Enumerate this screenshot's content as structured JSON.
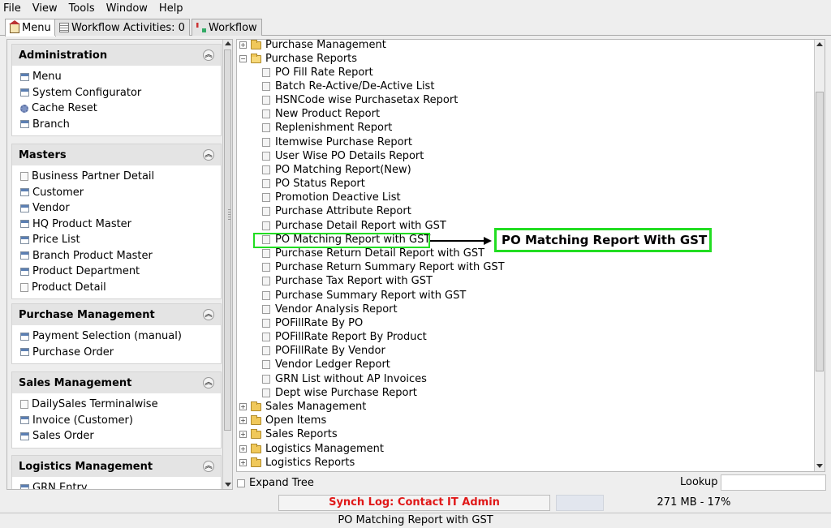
{
  "menubar": {
    "file": "File",
    "view": "View",
    "tools": "Tools",
    "window": "Window",
    "help": "Help"
  },
  "tabs": {
    "menu": "Menu",
    "workflow_activities": "Workflow Activities: 0",
    "workflow": "Workflow"
  },
  "sidebar": {
    "sections": [
      {
        "title": "Administration",
        "items": [
          {
            "label": "Menu",
            "icon": "window-icon"
          },
          {
            "label": "System Configurator",
            "icon": "window-icon"
          },
          {
            "label": "Cache Reset",
            "icon": "gear-icon"
          },
          {
            "label": "Branch",
            "icon": "window-icon"
          }
        ]
      },
      {
        "title": "Masters",
        "items": [
          {
            "label": "Business Partner Detail",
            "icon": "document-icon"
          },
          {
            "label": "Customer",
            "icon": "window-icon"
          },
          {
            "label": "Vendor",
            "icon": "window-icon"
          },
          {
            "label": "HQ Product Master",
            "icon": "window-icon"
          },
          {
            "label": "Price List",
            "icon": "window-icon"
          },
          {
            "label": "Branch Product Master",
            "icon": "window-icon"
          },
          {
            "label": "Product Department",
            "icon": "window-icon"
          },
          {
            "label": "Product Detail",
            "icon": "document-icon"
          }
        ]
      },
      {
        "title": "Purchase Management",
        "items": [
          {
            "label": "Payment Selection (manual)",
            "icon": "window-icon"
          },
          {
            "label": "Purchase Order",
            "icon": "window-icon"
          }
        ]
      },
      {
        "title": "Sales Management",
        "items": [
          {
            "label": "DailySales Terminalwise",
            "icon": "document-icon"
          },
          {
            "label": "Invoice (Customer)",
            "icon": "window-icon"
          },
          {
            "label": "Sales Order",
            "icon": "window-icon"
          }
        ]
      },
      {
        "title": "Logistics Management",
        "items": [
          {
            "label": "GRN Entry",
            "icon": "window-icon"
          }
        ]
      }
    ]
  },
  "tree": {
    "nodes": [
      {
        "label": "Purchase Management",
        "type": "folder",
        "expanded": false,
        "level": 0
      },
      {
        "label": "Purchase Reports",
        "type": "folder",
        "expanded": true,
        "level": 0
      },
      {
        "label": "PO Fill Rate Report",
        "type": "report",
        "level": 1
      },
      {
        "label": "Batch Re-Active/De-Active List",
        "type": "report",
        "level": 1
      },
      {
        "label": "HSNCode wise Purchasetax Report",
        "type": "report",
        "level": 1
      },
      {
        "label": "New Product Report",
        "type": "report",
        "level": 1
      },
      {
        "label": "Replenishment Report",
        "type": "report",
        "level": 1
      },
      {
        "label": "Itemwise Purchase Report",
        "type": "report",
        "level": 1
      },
      {
        "label": "User Wise PO Details Report",
        "type": "report",
        "level": 1
      },
      {
        "label": "PO Matching Report(New)",
        "type": "report",
        "level": 1
      },
      {
        "label": "PO Status Report",
        "type": "report",
        "level": 1
      },
      {
        "label": "Promotion Deactive List",
        "type": "report",
        "level": 1
      },
      {
        "label": "Purchase Attribute Report",
        "type": "report",
        "level": 1
      },
      {
        "label": "Purchase Detail Report with GST",
        "type": "report",
        "level": 1
      },
      {
        "label": "PO Matching Report with GST",
        "type": "report",
        "level": 1,
        "highlighted": true
      },
      {
        "label": "Purchase Return Detail Report with GST",
        "type": "report",
        "level": 1
      },
      {
        "label": "Purchase Return Summary Report with GST",
        "type": "report",
        "level": 1
      },
      {
        "label": "Purchase Tax Report with GST",
        "type": "report",
        "level": 1
      },
      {
        "label": "Purchase Summary Report with GST",
        "type": "report",
        "level": 1
      },
      {
        "label": "Vendor Analysis Report",
        "type": "report",
        "level": 1
      },
      {
        "label": "POFillRate By PO",
        "type": "report",
        "level": 1
      },
      {
        "label": "POFillRate Report By Product",
        "type": "report",
        "level": 1
      },
      {
        "label": "POFillRate By Vendor",
        "type": "report",
        "level": 1
      },
      {
        "label": "Vendor Ledger Report",
        "type": "report",
        "level": 1
      },
      {
        "label": "GRN List without AP Invoices",
        "type": "report",
        "level": 1
      },
      {
        "label": "Dept wise Purchase Report",
        "type": "report",
        "level": 1
      },
      {
        "label": "Sales Management",
        "type": "folder",
        "expanded": false,
        "level": 0
      },
      {
        "label": "Open Items",
        "type": "folder",
        "expanded": false,
        "level": 0
      },
      {
        "label": "Sales Reports",
        "type": "folder",
        "expanded": false,
        "level": 0
      },
      {
        "label": "Logistics Management",
        "type": "folder",
        "expanded": false,
        "level": 0
      },
      {
        "label": "Logistics Reports",
        "type": "folder",
        "expanded": false,
        "level": 0
      }
    ]
  },
  "annotation": {
    "callout_text": "PO Matching Report With GST",
    "color": "#22dd22"
  },
  "bottom": {
    "expand_tree_label": "Expand Tree",
    "expand_tree_checked": false,
    "lookup_label": "Lookup",
    "lookup_value": "",
    "synch_log": "Synch Log: Contact IT Admin",
    "memory": "271 MB - 17%",
    "status_text": "PO Matching Report with GST"
  }
}
